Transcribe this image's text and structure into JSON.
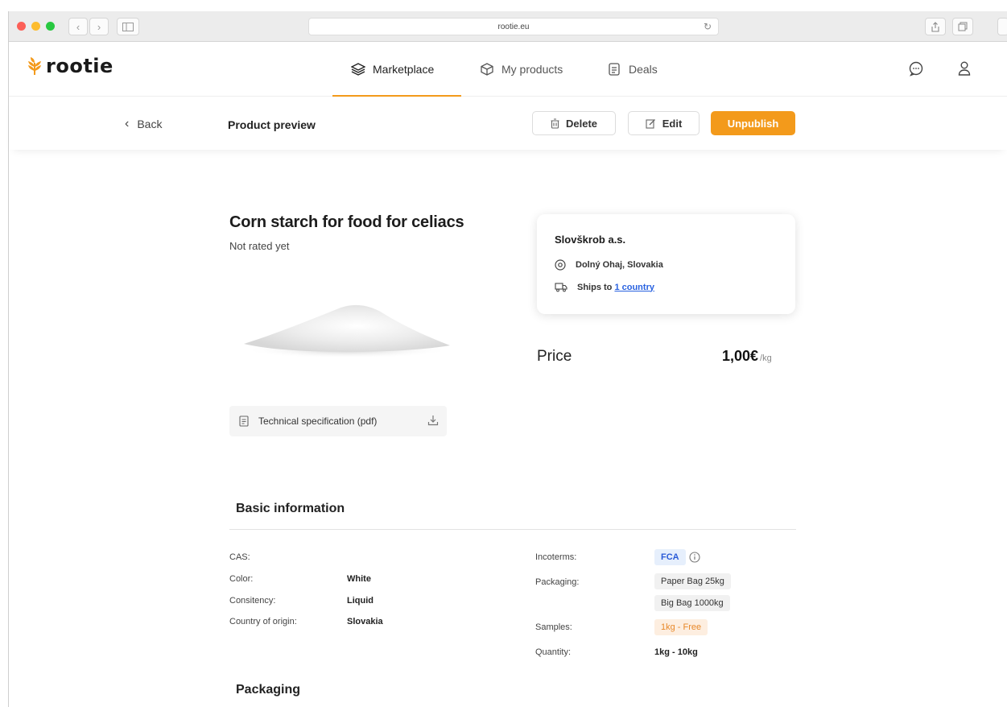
{
  "browser": {
    "url": "rootie.eu"
  },
  "brand": {
    "name": "rootie",
    "accent": "#f39a1b"
  },
  "nav": {
    "items": [
      {
        "label": "Marketplace",
        "icon": "layers-icon",
        "active": true
      },
      {
        "label": "My products",
        "icon": "box-icon",
        "active": false
      },
      {
        "label": "Deals",
        "icon": "handshake-icon",
        "active": false
      }
    ]
  },
  "header": {
    "icons": [
      "chat-icon",
      "user-icon"
    ]
  },
  "toolbar": {
    "back_label": "Back",
    "title": "Product preview",
    "delete_label": "Delete",
    "edit_label": "Edit",
    "unpublish_label": "Unpublish"
  },
  "product": {
    "title": "Corn starch for food for celiacs",
    "rating": "Not rated yet",
    "spec_file": "Technical specification (pdf)"
  },
  "seller": {
    "name": "Slovškrob a.s.",
    "location": "Dolný Ohaj, Slovakia",
    "ships_prefix": "Ships to",
    "ships_link": "1 country"
  },
  "price": {
    "label": "Price",
    "value": "1,00€",
    "unit": "/kg"
  },
  "basic_info": {
    "title": "Basic information",
    "left": [
      {
        "label": "CAS:",
        "value": ""
      },
      {
        "label": "Color:",
        "value": "White"
      },
      {
        "label": "Consitency:",
        "value": "Liquid"
      },
      {
        "label": "Country of origin:",
        "value": "Slovakia"
      }
    ],
    "incoterms_label": "Incoterms:",
    "incoterms_value": "FCA",
    "packaging_label": "Packaging:",
    "packaging_values": [
      "Paper Bag 25kg",
      "Big Bag 1000kg"
    ],
    "samples_label": "Samples:",
    "samples_value": "1kg - Free",
    "quantity_label": "Quantity:",
    "quantity_value": "1kg - 10kg"
  },
  "packaging_section": {
    "title": "Packaging"
  }
}
